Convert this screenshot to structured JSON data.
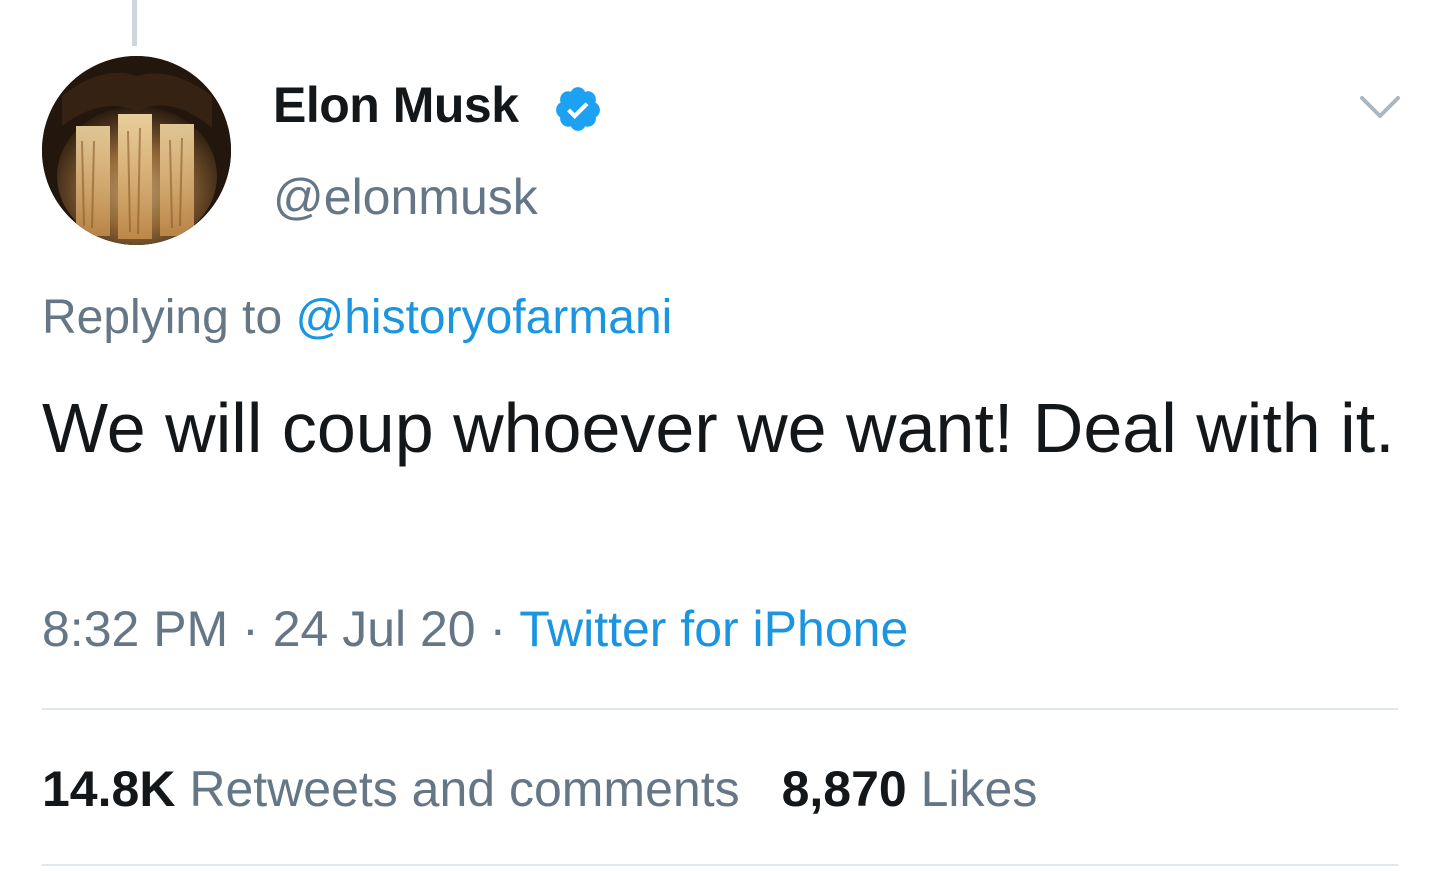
{
  "tweet": {
    "author": {
      "name": "Elon Musk",
      "handle": "@elonmusk",
      "verified": true
    },
    "reply": {
      "prefix": "Replying to",
      "mention": "@historyofarmani"
    },
    "text": "We will coup whoever we want! Deal with it.",
    "meta": {
      "time": "8:32 PM",
      "separator1": "·",
      "date": "24 Jul 20",
      "separator2": "·",
      "source": "Twitter for iPhone"
    },
    "stats": {
      "retweets_count": "14.8K",
      "retweets_label": "Retweets and comments",
      "likes_count": "8,870",
      "likes_label": "Likes"
    }
  },
  "icons": {
    "verified": "verified-badge-icon",
    "menu": "chevron-down-icon"
  },
  "colors": {
    "text_primary": "#14171a",
    "text_secondary": "#657786",
    "link": "#1b95e0",
    "verified": "#1da1f2",
    "divider": "#e1e8ed"
  }
}
